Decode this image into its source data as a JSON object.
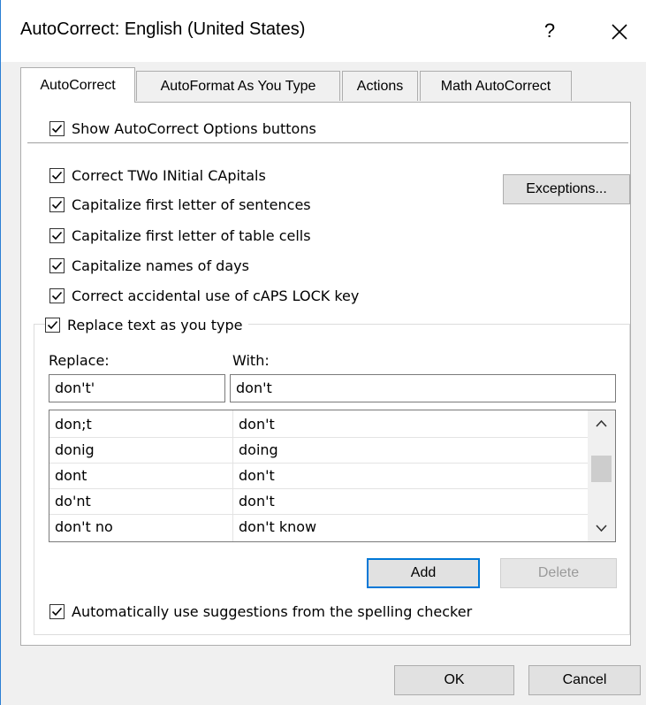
{
  "window": {
    "title": "AutoCorrect: English (United States)",
    "help_label": "?",
    "close_icon": "close-icon"
  },
  "tabs": [
    {
      "label": "AutoCorrect",
      "active": true
    },
    {
      "label": "AutoFormat As You Type",
      "active": false
    },
    {
      "label": "Actions",
      "active": false
    },
    {
      "label": "Math AutoCorrect",
      "active": false
    }
  ],
  "options": {
    "show_buttons": {
      "label": "Show AutoCorrect Options buttons",
      "checked": true
    },
    "correct_two_initials": {
      "label": "Correct TWo INitial CApitals",
      "checked": true
    },
    "cap_first_sentence": {
      "label": "Capitalize first letter of sentences",
      "checked": true
    },
    "cap_first_table": {
      "label": "Capitalize first letter of table cells",
      "checked": true
    },
    "cap_days": {
      "label": "Capitalize names of days",
      "checked": true
    },
    "caps_lock": {
      "label": "Correct accidental use of cAPS LOCK key",
      "checked": true
    },
    "replace_as_type": {
      "label": "Replace text as you type",
      "checked": true
    },
    "use_suggestions": {
      "label": "Automatically use suggestions from the spelling checker",
      "checked": true
    }
  },
  "buttons": {
    "exceptions": "Exceptions...",
    "add": "Add",
    "delete": "Delete",
    "ok": "OK",
    "cancel": "Cancel"
  },
  "replace_section": {
    "replace_label": "Replace:",
    "with_label": "With:",
    "replace_value": "don't'",
    "with_value": "don't"
  },
  "entries": [
    {
      "replace": "don;t",
      "with": "don't"
    },
    {
      "replace": "donig",
      "with": "doing"
    },
    {
      "replace": "dont",
      "with": "don't"
    },
    {
      "replace": "do'nt",
      "with": "don't"
    },
    {
      "replace": "don't no",
      "with": "don't know"
    }
  ],
  "colors": {
    "accent": "#0078d7",
    "window_bg": "#f0f0f0",
    "panel_bg": "#ffffff"
  }
}
